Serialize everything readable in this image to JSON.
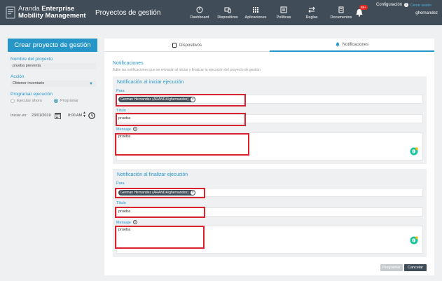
{
  "header": {
    "brand_line1": "Aranda",
    "brand_line1_bold": "Enterprise",
    "brand_line2": "Mobility Management",
    "page_title": "Proyectos de gestión",
    "nav": [
      {
        "label": "Dashboard",
        "icon": "dashboard-icon"
      },
      {
        "label": "Dispositivos",
        "icon": "devices-icon"
      },
      {
        "label": "Aplicaciones",
        "icon": "apps-icon"
      },
      {
        "label": "Políticas",
        "icon": "policies-icon"
      },
      {
        "label": "Reglas",
        "icon": "rules-icon"
      },
      {
        "label": "Documentos",
        "icon": "documents-icon"
      }
    ],
    "notifications_badge": "99+",
    "config_label": "Configuración",
    "logout_label": "Cerrar sesión",
    "user": "ghernandez"
  },
  "left": {
    "title": "Crear proyecto de gestión",
    "project_name_label": "Nombre del proyecto",
    "project_name_value": "prueba preventa",
    "action_label": "Acción",
    "action_value": "Obtener inventario",
    "schedule_label": "Programar ejecución",
    "option_now": "Ejecutar ahora",
    "option_schedule": "Programar",
    "start_label": "Iniciar en:",
    "start_date": "23/01/2019",
    "start_time": "8:00 AM"
  },
  "tabs": [
    {
      "label": "Dispositivos"
    },
    {
      "label": "Notificaciones"
    }
  ],
  "notifications": {
    "title": "Notificaciones",
    "description": "Edite las notificaciones que se enviarán al iniciar y finalizar la ejecución del proyecto de gestión",
    "start": {
      "title": "Notificación al iniciar ejecución",
      "to_label": "Para",
      "to_chip": "German Hernandez (ARANDA\\ghernandez)",
      "subject_label": "Título",
      "subject_value": "prueba",
      "message_label": "Mensaje",
      "message_value": "prueba"
    },
    "end": {
      "title": "Notificación al finalizar ejecución",
      "to_label": "Para",
      "to_chip": "German Hernandez (ARANDA\\ghernandez)",
      "subject_label": "Título",
      "subject_value": "prueba",
      "message_label": "Mensaje",
      "message_value": "prueba"
    }
  },
  "buttons": {
    "schedule": "Programar",
    "cancel": "Cancelar"
  },
  "colors": {
    "accent": "#2696c9",
    "header_bg": "#404c57",
    "highlight": "#d9232f"
  }
}
